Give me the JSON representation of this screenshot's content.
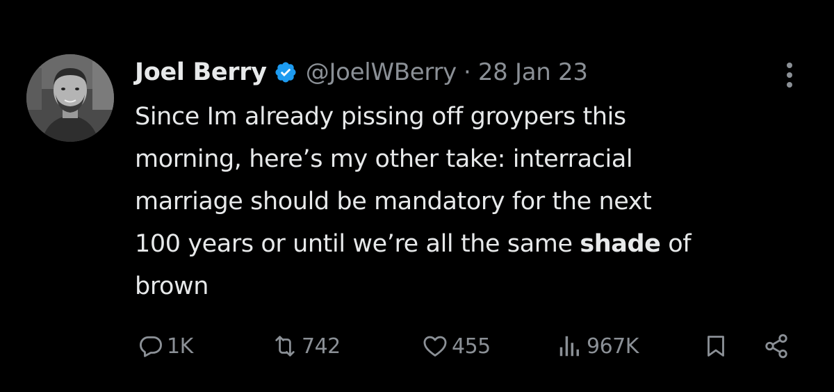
{
  "tweet": {
    "author": {
      "display_name": "Joel Berry",
      "handle": "@JoelWBerry",
      "verified": true
    },
    "separator": "·",
    "date": "28 Jan 23",
    "text_lines": [
      "Since Im already pissing off groypers this",
      "morning, here’s my other take: interracial",
      "marriage should be mandatory for the next"
    ],
    "text_line4_prefix": "100 years or until we’re all the same ",
    "text_line4_bold": "shade",
    "text_line4_suffix": " of",
    "text_line5": "brown",
    "actions": {
      "replies": "1K",
      "reposts": "742",
      "likes": "455",
      "views": "967K"
    }
  },
  "icons": [
    "verified-badge-icon",
    "more-icon",
    "reply-icon",
    "repost-icon",
    "like-icon",
    "views-icon",
    "bookmark-icon",
    "share-icon"
  ],
  "colors": {
    "background": "#000000",
    "text": "#e7e9ea",
    "secondary": "#8b9096",
    "verified": "#1d9bf0"
  }
}
